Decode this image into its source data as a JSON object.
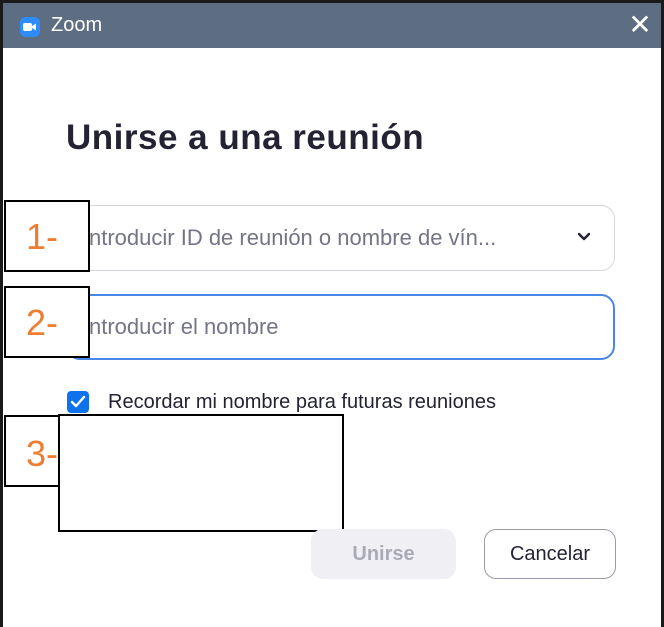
{
  "window": {
    "title": "Zoom",
    "close_glyph": "✕",
    "app_icon": "zoom-camera-icon"
  },
  "dialog": {
    "heading": "Unirse a una reunión",
    "meeting_id_field": {
      "placeholder": "ntroducir ID de reunión o nombre de vín...",
      "icon": "chevron-down-icon"
    },
    "name_field": {
      "placeholder": "ntroducir el nombre"
    },
    "remember_name": {
      "checked": true,
      "label": "Recordar mi nombre para futuras reuniones"
    },
    "buttons": {
      "join": "Unirse",
      "cancel": "Cancelar"
    }
  },
  "annotations": {
    "label_1": "1-",
    "label_2": "2-",
    "label_3": "3-",
    "color": "#ed7d31"
  },
  "colors": {
    "titlebar": "#5d6d82",
    "accent": "#0e72ed",
    "focus_border": "#4a86e8"
  }
}
